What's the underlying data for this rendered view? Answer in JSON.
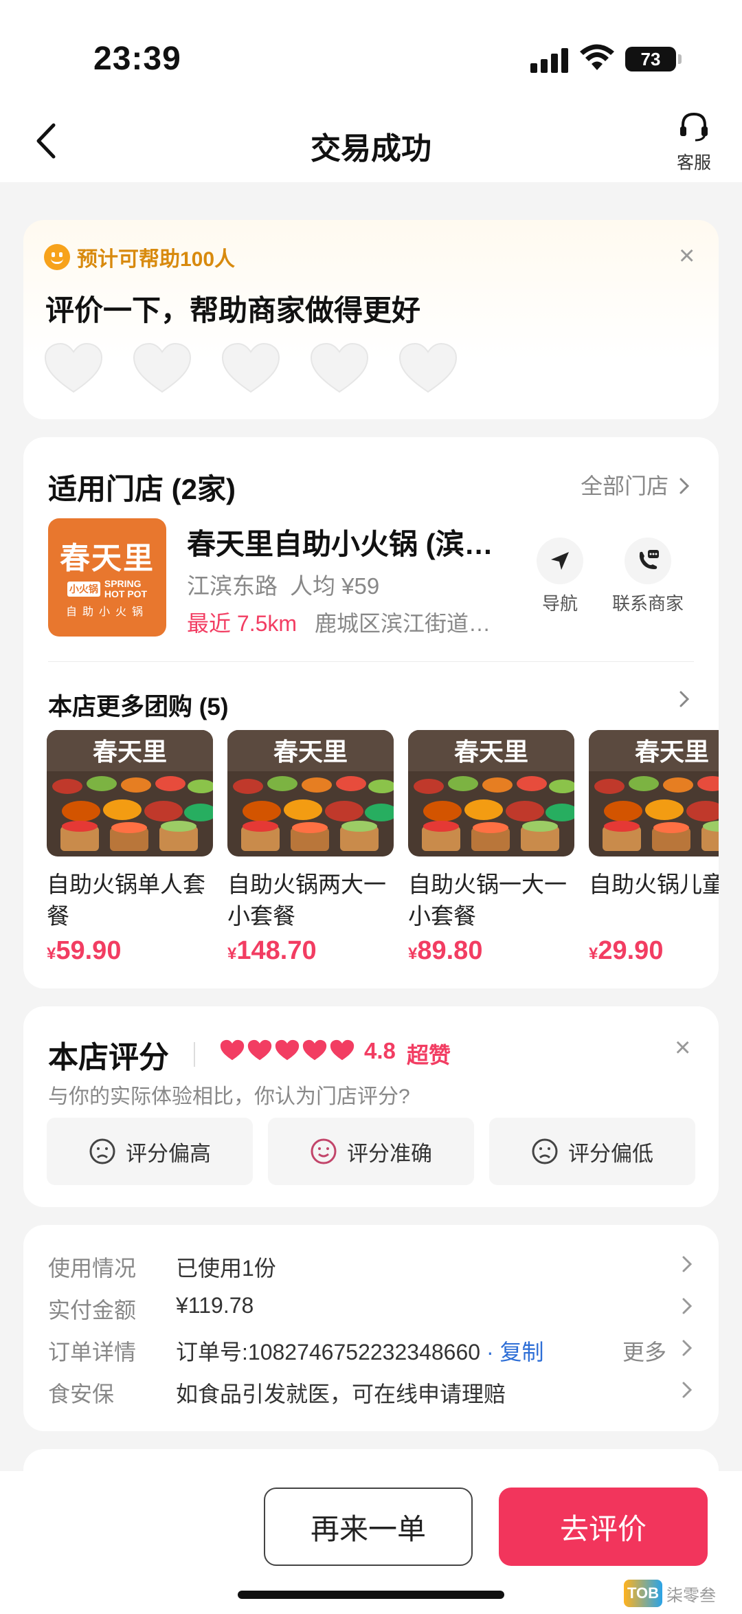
{
  "status_bar": {
    "time": "23:39",
    "battery": "73"
  },
  "nav": {
    "title": "交易成功",
    "customer_service": "客服"
  },
  "rating_prompt": {
    "help_text": "预计可帮助100人",
    "title": "评价一下，帮助商家做得更好",
    "heart_count": 5
  },
  "store_section": {
    "title": "适用门店 (2家)",
    "all_stores": "全部门店",
    "logo": {
      "title": "春天里",
      "badge": "小火锅",
      "en_line1": "SPRING",
      "en_line2": "HOT POT",
      "cn": "自助小火锅"
    },
    "store": {
      "name": "春天里自助小火锅 (滨…",
      "road": "江滨东路",
      "avg_price": "人均 ¥59",
      "distance": "最近 7.5km",
      "address": "鹿城区滨江街道…"
    },
    "actions": {
      "navigate": "导航",
      "contact": "联系商家"
    },
    "more_title": "本店更多团购 (5)",
    "deal_image_title": "春天里",
    "deals": [
      {
        "name": "自助火锅单人套餐",
        "currency": "¥",
        "price": "59.90"
      },
      {
        "name": "自助火锅两大一小套餐",
        "currency": "¥",
        "price": "148.70"
      },
      {
        "name": "自助火锅一大一小套餐",
        "currency": "¥",
        "price": "89.80"
      },
      {
        "name": "自助火锅儿童餐",
        "currency": "¥",
        "price": "29.90"
      }
    ]
  },
  "score_section": {
    "title": "本店评分",
    "score": "4.8",
    "score_word": "超赞",
    "question": "与你的实际体验相比，你认为门店评分?",
    "options": [
      "评分偏高",
      "评分准确",
      "评分偏低"
    ],
    "colors": {
      "accent": "#f23d62"
    }
  },
  "order_info": {
    "rows": [
      {
        "label": "使用情况",
        "value": "已使用1份"
      },
      {
        "label": "实付金额",
        "value": "¥119.78"
      },
      {
        "label": "订单详情",
        "value": "订单号:1082746752232348660",
        "copy": "· 复制",
        "more": "更多"
      },
      {
        "label": "食安保",
        "value": "如食品引发就医，可在线申请理赔"
      }
    ]
  },
  "bottom_bar": {
    "reorder": "再来一单",
    "review": "去评价"
  },
  "watermark": {
    "logo": "TOB",
    "text": "柒零叁"
  }
}
